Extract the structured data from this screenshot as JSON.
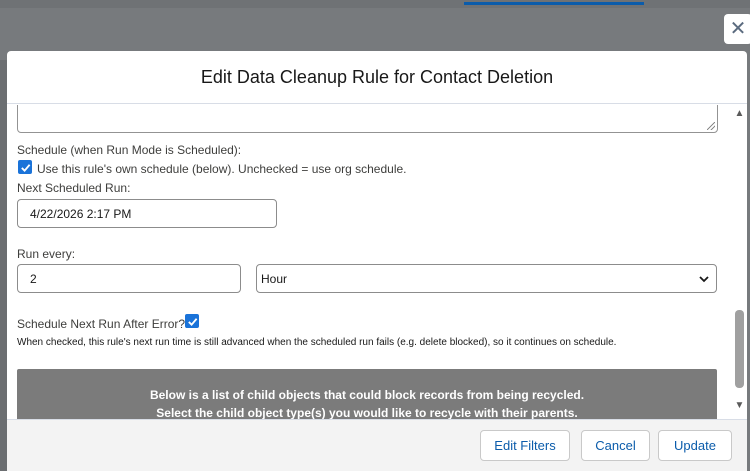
{
  "modal": {
    "title": "Edit Data Cleanup Rule for Contact Deletion",
    "close_label": "✕"
  },
  "schedule": {
    "section_label": "Schedule (when Run Mode is Scheduled):",
    "own_schedule_checked": true,
    "own_schedule_label": "Use this rule's own schedule (below). Unchecked = use org schedule.",
    "next_run_label": "Next Scheduled Run:",
    "next_run_value": "4/22/2026 2:17 PM",
    "run_every_label": "Run every:",
    "run_every_value": "2",
    "run_every_unit": "Hour",
    "after_error_label": "Schedule Next Run After Error?:",
    "after_error_checked": true,
    "after_error_help": "When checked, this rule's next run time is still advanced when the scheduled run fails (e.g. delete blocked), so it continues on schedule."
  },
  "child_objects_banner": {
    "line1": "Below is a list of child objects that could block records from being recycled.",
    "line2": "Select the child object type(s) you would like to recycle with their parents."
  },
  "footer": {
    "edit_filters_label": "Edit Filters",
    "cancel_label": "Cancel",
    "update_label": "Update"
  },
  "scrollbar": {
    "up_glyph": "▲",
    "down_glyph": "▼"
  },
  "colors": {
    "accent": "#0b5cab",
    "checkbox": "#1a73d9",
    "banner": "#7b7b7b",
    "backdrop": "#777a7d"
  }
}
